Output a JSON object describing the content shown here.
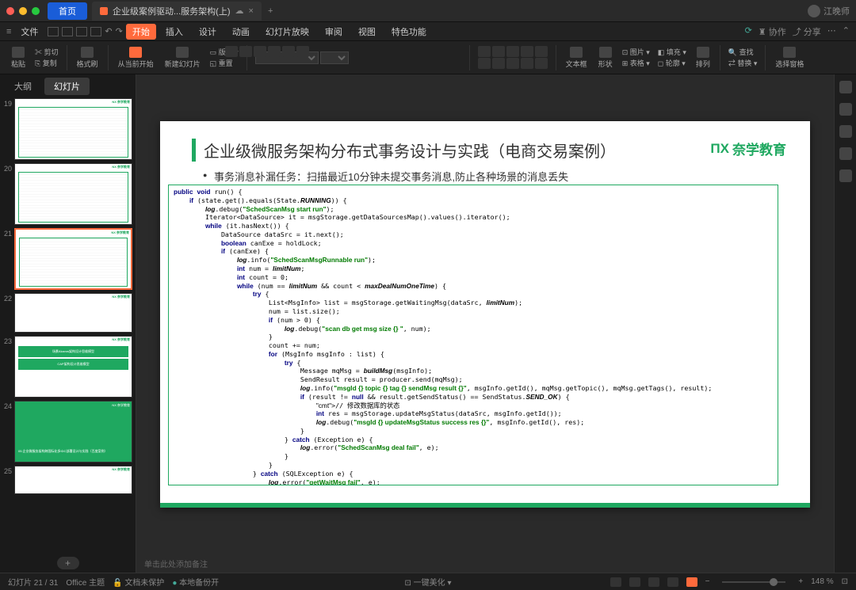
{
  "titlebar": {
    "home": "首页",
    "filename": "企业级案例驱动...服务架构(上)",
    "user": "江晚师"
  },
  "menubar": {
    "file": "文件",
    "items": [
      "开始",
      "插入",
      "设计",
      "动画",
      "幻灯片放映",
      "审阅",
      "视图",
      "特色功能"
    ],
    "coop": "协作",
    "share": "分享"
  },
  "ribbon": {
    "paste": "粘贴",
    "cut": "剪切",
    "copy": "复制",
    "format_brush": "格式刷",
    "start_from": "从当前开始",
    "new_slide": "新建幻灯片",
    "reset": "重置",
    "layout": "版式",
    "text_box": "文本框",
    "shape": "形状",
    "arrange": "排列",
    "image": "图片",
    "table": "表格",
    "fill": "填充",
    "outline": "轮廓",
    "find": "查找",
    "replace": "替换",
    "select_pane": "选择窗格"
  },
  "sidebar": {
    "outline": "大纲",
    "slides": "幻灯片",
    "numbers": [
      "19",
      "20",
      "21",
      "22",
      "23",
      "24",
      "25"
    ]
  },
  "slide": {
    "title": "企业级微服务架构分布式事务设计与实践（电商交易案例）",
    "logo_nx": "ΠX",
    "logo_text": "奈学教育",
    "bullet": "事务消息补漏任务：扫描最近10分钟未提交事务消息,防止各种场景的消息丢失",
    "code": "public void run() {\n    if (state.get().equals(State.RUNNING)) {\n        log.debug(\"SchedScanMsg start run\");\n        Iterator<DataSource> it = msgStorage.getDataSourcesMap().values().iterator();\n        while (it.hasNext()) {\n            DataSource dataSrc = it.next();\n            boolean canExe = holdLock;\n            if (canExe) {\n                log.info(\"SchedScanMsgRunnable run\");\n                int num = limitNum;\n                int count = 0;\n                while (num == limitNum && count < maxDealNumOneTime) {\n                    try {\n                        List<MsgInfo> list = msgStorage.getWaitingMsg(dataSrc, limitNum);\n                        num = list.size();\n                        if (num > 0) {\n                            log.debug(\"scan db get msg size {} \", num);\n                        }\n                        count += num;\n                        for (MsgInfo msgInfo : list) {\n                            try {\n                                Message mqMsg = buildMsg(msgInfo);\n                                SendResult result = producer.send(mqMsg);\n                                log.info(\"msgId {} topic {} tag {} sendMsg result {}\", msgInfo.getId(), mqMsg.getTopic(), mqMsg.getTags(), result);\n                                if (result != null && result.getSendStatus() == SendStatus.SEND_OK) {\n                                    // 修改数据库的状态\n                                    int res = msgStorage.updateMsgStatus(dataSrc, msgInfo.getId());\n                                    log.debug(\"msgId {} updateMsgStatus success res {}\", msgInfo.getId(), res);\n                                }\n                            } catch (Exception e) {\n                                log.error(\"SchedScanMsg deal fail\", e);\n                            }\n                        }\n                    } catch (SQLException e) {\n                        log.error(\"getWaitMsg fail\", e);\n                    }\n                }\n            }\n        }"
  },
  "notes_hint": "单击此处添加备注",
  "status": {
    "slide_count": "幻灯片 21 / 31",
    "theme": "Office 主题",
    "protect": "文档未保护",
    "backup": "本地备份开",
    "beautify": "一键美化",
    "zoom": "148 %"
  }
}
